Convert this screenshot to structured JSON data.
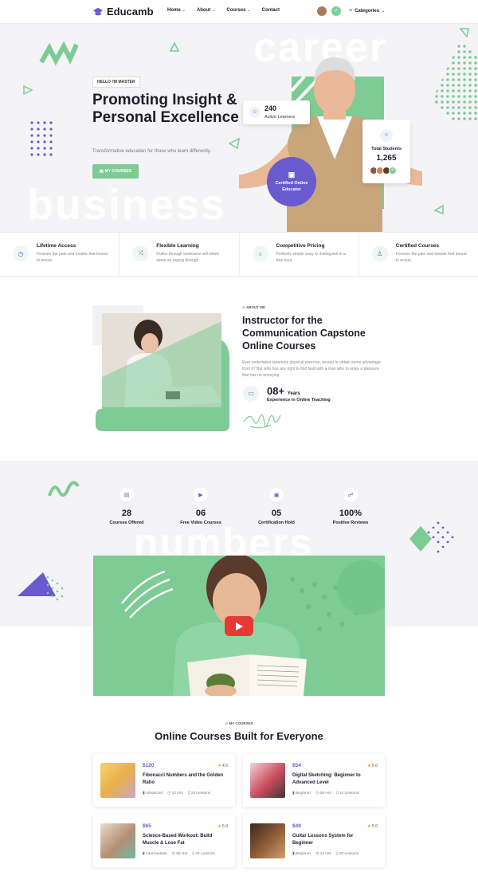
{
  "header": {
    "brand": "Educamb",
    "nav": [
      {
        "label": "Home",
        "has_dropdown": true
      },
      {
        "label": "About",
        "has_dropdown": true
      },
      {
        "label": "Courses",
        "has_dropdown": true
      },
      {
        "label": "Contact",
        "has_dropdown": false
      }
    ],
    "categories_label": "Categories"
  },
  "hero": {
    "ghost_top": "career",
    "ghost_bottom": "business",
    "badge": "HELLO I'M MASTER",
    "title": "Promoting Insight & Personal Excellence",
    "subtitle": "Transformative education for those who learn differently.",
    "button": "MY COURSES",
    "learners_value": "240",
    "learners_label": "Active Learners",
    "students_label": "Total Students",
    "students_value": "1,265",
    "certified_label": "Certified Online Educator"
  },
  "features": [
    {
      "icon": "clock-icon",
      "title": "Lifetime Access",
      "desc": "Foresee the pain and trouble that bound to ensue."
    },
    {
      "icon": "shuffle-icon",
      "title": "Flexible Learning",
      "desc": "Duties through weakness will which same as saying through."
    },
    {
      "icon": "piggy-icon",
      "title": "Competitive Pricing",
      "desc": "Perfectly simple easy to distinguish in a free hour."
    },
    {
      "icon": "certificate-icon",
      "title": "Certified Courses",
      "desc": "Foresee the pain and trouble that bound to ensue."
    }
  ],
  "about": {
    "label": "ABOUT ME",
    "title": "Instructor for the Communication Capstone Online Courses",
    "desc": "Ever undertakes laborious physical exercise, except to obtain some advantage from it? But who has any right to find fault with a man who to enjoy a pleasure that has no annoying.",
    "experience_value": "08+",
    "experience_unit": "Years",
    "experience_label": "Experience in Online Teaching"
  },
  "numbers": {
    "ghost": "numbers",
    "items": [
      {
        "icon": "book-icon",
        "value": "28",
        "label": "Courses Offered"
      },
      {
        "icon": "video-icon",
        "value": "06",
        "label": "Free Video Courses"
      },
      {
        "icon": "certificate-icon",
        "value": "05",
        "label": "Certification Hold"
      },
      {
        "icon": "reviews-icon",
        "value": "100%",
        "label": "Positive Reviews"
      }
    ]
  },
  "courses": {
    "label": "MY COURSES",
    "title": "Online Courses Built for Everyone",
    "items": [
      {
        "price": "$120",
        "rating": "4.5",
        "name": "Fibonacci Numbers and the Golden Ratio",
        "level": "Advanced",
        "hours": "12 Hrs",
        "lessons": "24 Lessons",
        "thumb_color": "#e8b04a"
      },
      {
        "price": "$54",
        "rating": "5.0",
        "name": "Digital Sketching: Beginner to Advanced Level",
        "level": "Beginner",
        "hours": "08 Hrs",
        "lessons": "14 Lessons",
        "thumb_color": "#c94b5c"
      },
      {
        "price": "$65",
        "rating": "5.0",
        "name": "Science-Based Workout: Build Muscle & Lose Fat",
        "level": "Intermediate",
        "hours": "06 Hrs",
        "lessons": "24 Lessons",
        "thumb_color": "#b38f73"
      },
      {
        "price": "$49",
        "rating": "5.0",
        "name": "Guitar Lessons System for Beginner",
        "level": "Beginner",
        "hours": "12 Hrs",
        "lessons": "20 Lessons",
        "thumb_color": "#8a5a36"
      }
    ]
  },
  "colors": {
    "accent": "#6a5acd",
    "green": "#7ecb95",
    "bg_light": "#f4f4f6",
    "play": "#e53935"
  }
}
